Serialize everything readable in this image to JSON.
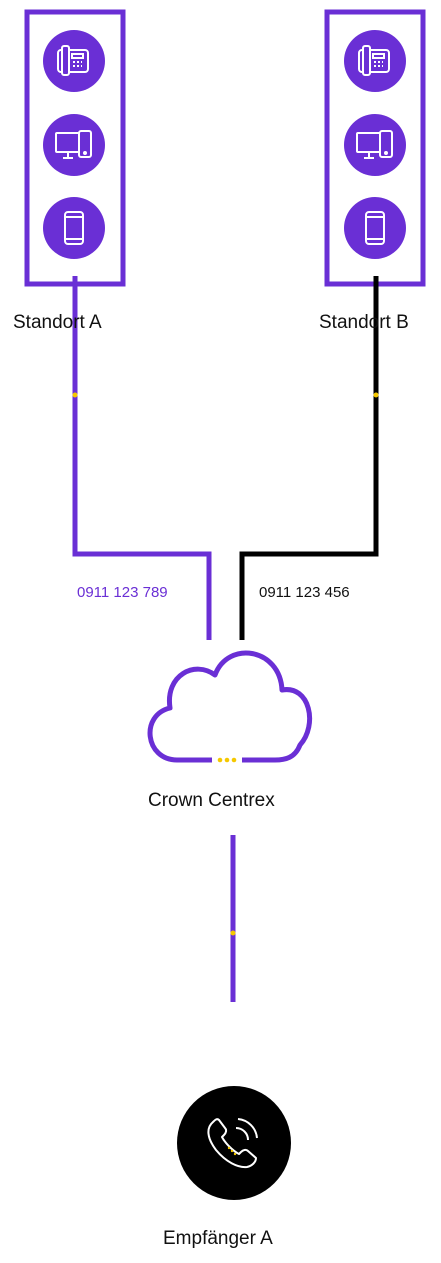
{
  "colors": {
    "purple": "#6a2fd5",
    "black": "#000000",
    "yellow": "#f5c800",
    "white": "#ffffff"
  },
  "sites": [
    {
      "label": "Standort A",
      "devices": [
        {
          "icon": "desk-phone-icon"
        },
        {
          "icon": "computer-icon"
        },
        {
          "icon": "mobile-phone-icon"
        }
      ]
    },
    {
      "label": "Standort B",
      "devices": [
        {
          "icon": "desk-phone-icon"
        },
        {
          "icon": "computer-icon"
        },
        {
          "icon": "mobile-phone-icon"
        }
      ]
    }
  ],
  "lines": [
    {
      "number": "0911 123 789",
      "color": "purple"
    },
    {
      "number": "0911 123 456",
      "color": "black"
    }
  ],
  "cloud": {
    "label": "Crown Centrex",
    "icon": "cloud-icon"
  },
  "receiver": {
    "label": "Empfänger A",
    "icon": "phone-call-icon"
  }
}
